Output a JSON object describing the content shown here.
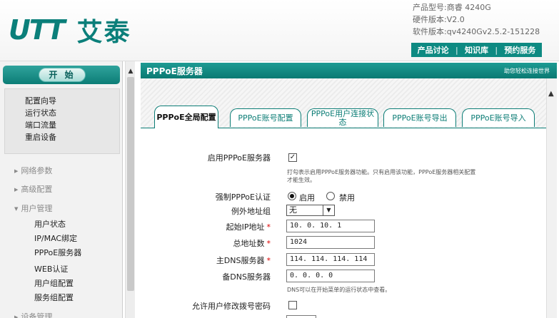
{
  "header": {
    "logo_mark": "UTT",
    "logo_cn": "艾泰",
    "product_info": [
      "产品型号:商睿 4240G",
      "硬件版本:V2.0",
      "软件版本:qv4240Gv2.5.2-151228"
    ],
    "links": [
      "产品讨论",
      "知识库",
      "预约服务"
    ],
    "link_separator": "|"
  },
  "sidebar": {
    "start_label": "开 始",
    "quick_items": [
      "配置向导",
      "运行状态",
      "端口流量",
      "重启设备"
    ],
    "groups": {
      "network": "网络参数",
      "advanced": "高级配置",
      "user": "用户管理",
      "next": "设备管理"
    },
    "user_items": [
      "用户状态",
      "IP/MAC绑定",
      "PPPoE服务器",
      "WEB认证",
      "用户组配置",
      "服务组配置"
    ]
  },
  "main": {
    "title": "PPPoE服务器",
    "help_link": "助您轻松连接世界",
    "tabs": [
      {
        "label": "PPPoE全局配置",
        "active": true
      },
      {
        "label": "PPPoE账号配置",
        "active": false
      },
      {
        "label": "PPPoE用户连接状态",
        "active": false
      },
      {
        "label": "PPPoE账号导出",
        "active": false
      },
      {
        "label": "PPPoE账号导入",
        "active": false
      }
    ]
  },
  "form": {
    "enable_label": "启用PPPoE服务器",
    "enable_checked": true,
    "enable_hint_1": "打勾表示启用PPPoE服务器功能。只有启用该功能，PPPoE服务器相关配置",
    "enable_hint_2": "才能生效。",
    "force_auth_label": "强制PPPoE认证",
    "force_auth_options": [
      "启用",
      "禁用"
    ],
    "force_auth_selected": "启用",
    "exception_group_label": "例外地址组",
    "exception_group_value": "无",
    "start_ip_label": "起始IP地址",
    "start_ip_value": "10. 0. 10. 1",
    "total_addr_label": "总地址数",
    "total_addr_value": "1024",
    "primary_dns_label": "主DNS服务器",
    "primary_dns_value": "114. 114. 114. 114",
    "secondary_dns_label": "备DNS服务器",
    "secondary_dns_value": "0. 0. 0. 0",
    "dns_hint": "DNS可以在开始菜单的运行状态中查看。",
    "allow_change_pwd_label": "允许用户修改拨号密码",
    "allow_change_pwd_checked": false,
    "required_mark": "*"
  },
  "colors": {
    "accent": "#0c7d76",
    "required": "#dd0000"
  }
}
